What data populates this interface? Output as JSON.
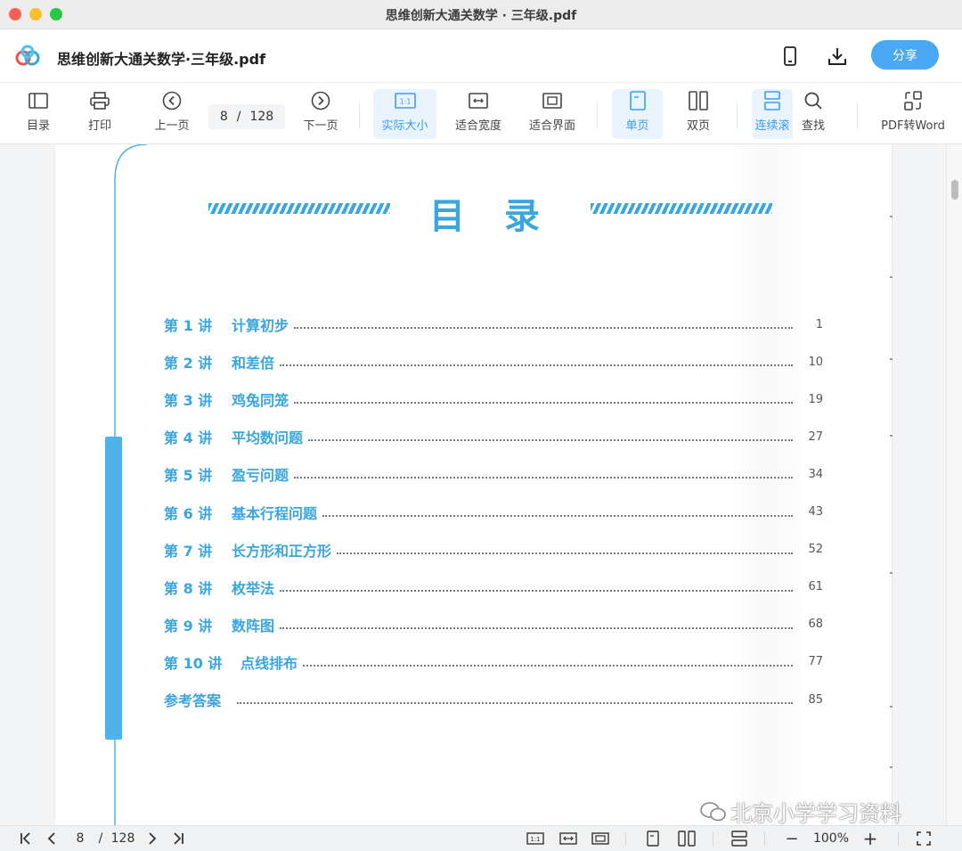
{
  "window": {
    "title": "思维创新大通关数学 · 三年级.pdf"
  },
  "header": {
    "doc_title": "思维创新大通关数学·三年级.pdf",
    "share_label": "分享",
    "icons": [
      "mobile-icon",
      "download-icon"
    ]
  },
  "toolbar": {
    "items": [
      {
        "label": "目录",
        "icon": "outline-icon"
      },
      {
        "label": "打印",
        "icon": "printer-icon"
      },
      {
        "label": "上一页",
        "icon": "chevron-left-icon"
      },
      {
        "label": "下一页",
        "icon": "chevron-right-icon"
      },
      {
        "label": "实际大小",
        "icon": "actual-size-icon",
        "active": true
      },
      {
        "label": "适合宽度",
        "icon": "fit-width-icon"
      },
      {
        "label": "适合界面",
        "icon": "fit-page-icon"
      },
      {
        "label": "单页",
        "icon": "single-page-icon",
        "active": true
      },
      {
        "label": "双页",
        "icon": "double-page-icon"
      },
      {
        "label": "连续滚",
        "icon": "continuous-scroll-icon",
        "active": true
      },
      {
        "label": "查找",
        "icon": "search-icon"
      },
      {
        "label": "PDF转Word",
        "icon": "convert-icon"
      }
    ],
    "current_page": "8",
    "separator": "/",
    "total_pages": "128"
  },
  "document": {
    "heading": "目录",
    "toc": [
      {
        "num": "第 1 讲",
        "title": "计算初步",
        "page": "1"
      },
      {
        "num": "第 2 讲",
        "title": "和差倍",
        "page": "10"
      },
      {
        "num": "第 3 讲",
        "title": "鸡兔同笼",
        "page": "19"
      },
      {
        "num": "第 4 讲",
        "title": "平均数问题",
        "page": "27"
      },
      {
        "num": "第 5 讲",
        "title": "盈亏问题",
        "page": "34"
      },
      {
        "num": "第 6 讲",
        "title": "基本行程问题",
        "page": "43"
      },
      {
        "num": "第 7 讲",
        "title": "长方形和正方形",
        "page": "52"
      },
      {
        "num": "第 8 讲",
        "title": "枚举法",
        "page": "61"
      },
      {
        "num": "第 9 讲",
        "title": "数阵图",
        "page": "68"
      },
      {
        "num": "第 10 讲",
        "title": "点线排布",
        "page": "77"
      },
      {
        "num": "参考答案",
        "title": "",
        "page": "85"
      }
    ]
  },
  "watermark": {
    "text": "北京小学学习资料"
  },
  "statusbar": {
    "current_page": "8",
    "separator": "/",
    "total_pages": "128",
    "zoom": "100%",
    "zoom_out": "−",
    "zoom_in": "+"
  },
  "colors": {
    "accent": "#4aa8f5",
    "toc_blue": "#3aa6e0",
    "bar_blue": "#4fb2e8"
  }
}
